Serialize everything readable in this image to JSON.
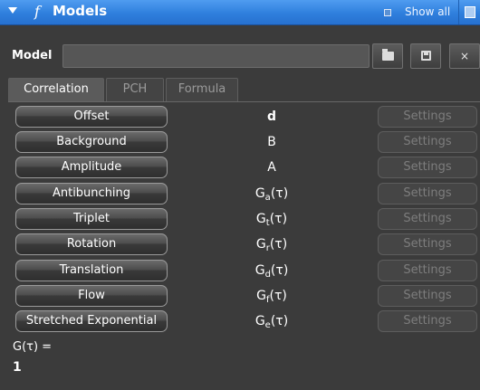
{
  "titlebar": {
    "icon": "f",
    "title": "Models",
    "show_all": "Show all"
  },
  "model": {
    "label": "Model",
    "value": "",
    "close_label": "×"
  },
  "tabs": [
    {
      "label": "Correlation",
      "active": true
    },
    {
      "label": "PCH",
      "active": false
    },
    {
      "label": "Formula",
      "active": false
    }
  ],
  "rows": [
    {
      "label": "Offset",
      "symbol": "d",
      "sub": "",
      "rest": "",
      "bold": true,
      "settings": "Settings"
    },
    {
      "label": "Background",
      "symbol": "B",
      "sub": "",
      "rest": "",
      "bold": false,
      "settings": "Settings"
    },
    {
      "label": "Amplitude",
      "symbol": "A",
      "sub": "",
      "rest": "",
      "bold": false,
      "settings": "Settings"
    },
    {
      "label": "Antibunching",
      "symbol": "G",
      "sub": "a",
      "rest": "(τ)",
      "bold": false,
      "settings": "Settings"
    },
    {
      "label": "Triplet",
      "symbol": "G",
      "sub": "t",
      "rest": "(τ)",
      "bold": false,
      "settings": "Settings"
    },
    {
      "label": "Rotation",
      "symbol": "G",
      "sub": "r",
      "rest": "(τ)",
      "bold": false,
      "settings": "Settings"
    },
    {
      "label": "Translation",
      "symbol": "G",
      "sub": "d",
      "rest": "(τ)",
      "bold": false,
      "settings": "Settings"
    },
    {
      "label": "Flow",
      "symbol": "G",
      "sub": "f",
      "rest": "(τ)",
      "bold": false,
      "settings": "Settings"
    },
    {
      "label": "Stretched Exponential",
      "symbol": "G",
      "sub": "e",
      "rest": "(τ)",
      "bold": false,
      "settings": "Settings"
    }
  ],
  "result": {
    "label": "G(τ) =",
    "value": "1"
  },
  "colors": {
    "titlebar": "#2f7fdd",
    "panel": "#3b3b3b",
    "disabled_text": "#7d7d7d"
  }
}
